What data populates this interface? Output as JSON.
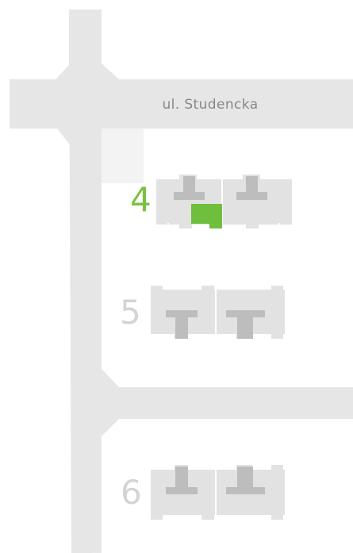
{
  "street": {
    "name": "ul. Studencka"
  },
  "buildings": [
    {
      "number": "4",
      "active": true
    },
    {
      "number": "5",
      "active": false
    },
    {
      "number": "6",
      "active": false
    }
  ],
  "colors": {
    "road": "#e6e6e6",
    "building": "#e2e2e2",
    "building_core": "#bdbdbd",
    "active_label": "#7cc043",
    "active_unit": "#6fbe3d",
    "inactive_label": "#d4d4d4",
    "street_label": "#888888"
  }
}
